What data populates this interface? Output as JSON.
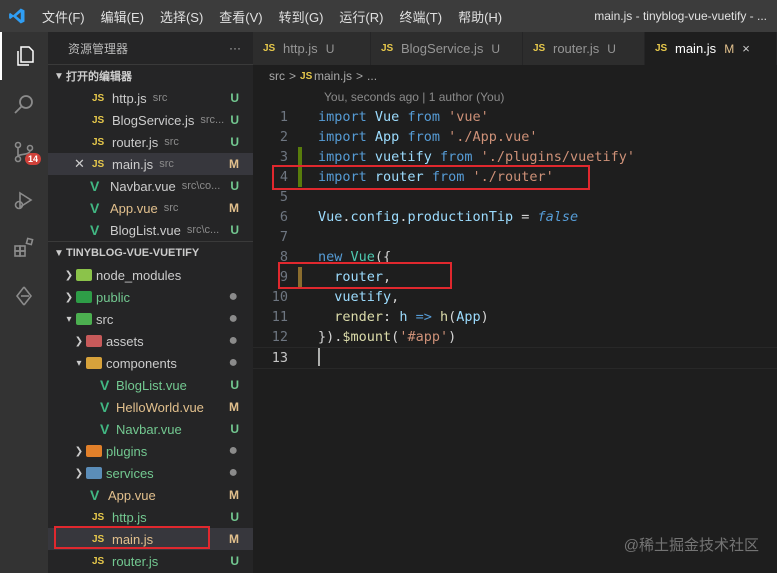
{
  "menu": [
    "文件(F)",
    "编辑(E)",
    "选择(S)",
    "查看(V)",
    "转到(G)",
    "运行(R)",
    "终端(T)",
    "帮助(H)"
  ],
  "window_title": "main.js - tinyblog-vue-vuetify - ...",
  "activity": {
    "scm_badge": "14"
  },
  "sidebar": {
    "title": "资源管理器",
    "more": "···",
    "open_editors_title": "打开的编辑器",
    "project_title": "TINYBLOG-VUE-VUETIFY",
    "open_editors": [
      {
        "icon": "JS",
        "name": "http.js",
        "desc": "src",
        "status": "U"
      },
      {
        "icon": "JS",
        "name": "BlogService.js",
        "desc": "src...",
        "status": "U"
      },
      {
        "icon": "JS",
        "name": "router.js",
        "desc": "src",
        "status": "U"
      },
      {
        "icon": "JS",
        "name": "main.js",
        "desc": "src",
        "status": "M"
      },
      {
        "icon": "V",
        "name": "Navbar.vue",
        "desc": "src\\co...",
        "status": "U"
      },
      {
        "icon": "V",
        "name": "App.vue",
        "desc": "src",
        "status": "M"
      },
      {
        "icon": "V",
        "name": "BlogList.vue",
        "desc": "src\\c...",
        "status": "U"
      }
    ],
    "tree": {
      "node_modules": "node_modules",
      "public": "public",
      "src": "src",
      "assets": "assets",
      "components": "components",
      "bloglist": "BlogList.vue",
      "helloworld": "HelloWorld.vue",
      "navbar": "Navbar.vue",
      "plugins": "plugins",
      "services": "services",
      "appvue": "App.vue",
      "httpjs": "http.js",
      "mainjs": "main.js",
      "routerjs": "router.js",
      "status_U": "U",
      "status_M": "M",
      "dot": "●"
    }
  },
  "tabs": [
    {
      "icon": "JS",
      "label": "http.js",
      "status": "U"
    },
    {
      "icon": "JS",
      "label": "BlogService.js",
      "status": "U"
    },
    {
      "icon": "JS",
      "label": "router.js",
      "status": "U"
    },
    {
      "icon": "JS",
      "label": "main.js",
      "status": "M",
      "close": "×"
    }
  ],
  "breadcrumb": {
    "folder": "src",
    "file": "main.js",
    "rest": "...",
    "sep": ">"
  },
  "codelens": "You, seconds ago | 1 author (You)",
  "code": {
    "l1": {
      "num": "1",
      "kw": "import",
      "id": "Vue",
      "from": "from",
      "str": "'vue'"
    },
    "l2": {
      "num": "2",
      "kw": "import",
      "id": "App",
      "from": "from",
      "str": "'./App.vue'"
    },
    "l3": {
      "num": "3",
      "kw": "import",
      "id": "vuetify",
      "from": "from",
      "str": "'./plugins/vuetify'"
    },
    "l4": {
      "num": "4",
      "kw": "import",
      "id": "router",
      "from": "from",
      "str": "'./router'"
    },
    "l5": {
      "num": "5"
    },
    "l6": {
      "num": "6",
      "a": "Vue",
      "b": ".",
      "c": "config",
      "d": ".",
      "e": "productionTip",
      "op": " = ",
      "val": "false"
    },
    "l7": {
      "num": "7"
    },
    "l8": {
      "num": "8",
      "kw": "new",
      "cls": "Vue",
      "p": "({"
    },
    "l9": {
      "num": "9",
      "id": "router",
      "p": ","
    },
    "l10": {
      "num": "10",
      "id": "vuetify",
      "p": ","
    },
    "l11": {
      "num": "11",
      "id": "render",
      "c": ": ",
      "h": "h",
      "arrow": " => ",
      "fn": "h",
      "args1": "(",
      "app": "App",
      "args2": ")"
    },
    "l12": {
      "num": "12",
      "p1": "}).",
      "fn": "$mount",
      "p2": "(",
      "str": "'#app'",
      "p3": ")"
    },
    "l13": {
      "num": "13"
    }
  },
  "watermark": "@稀土掘金技术社区"
}
